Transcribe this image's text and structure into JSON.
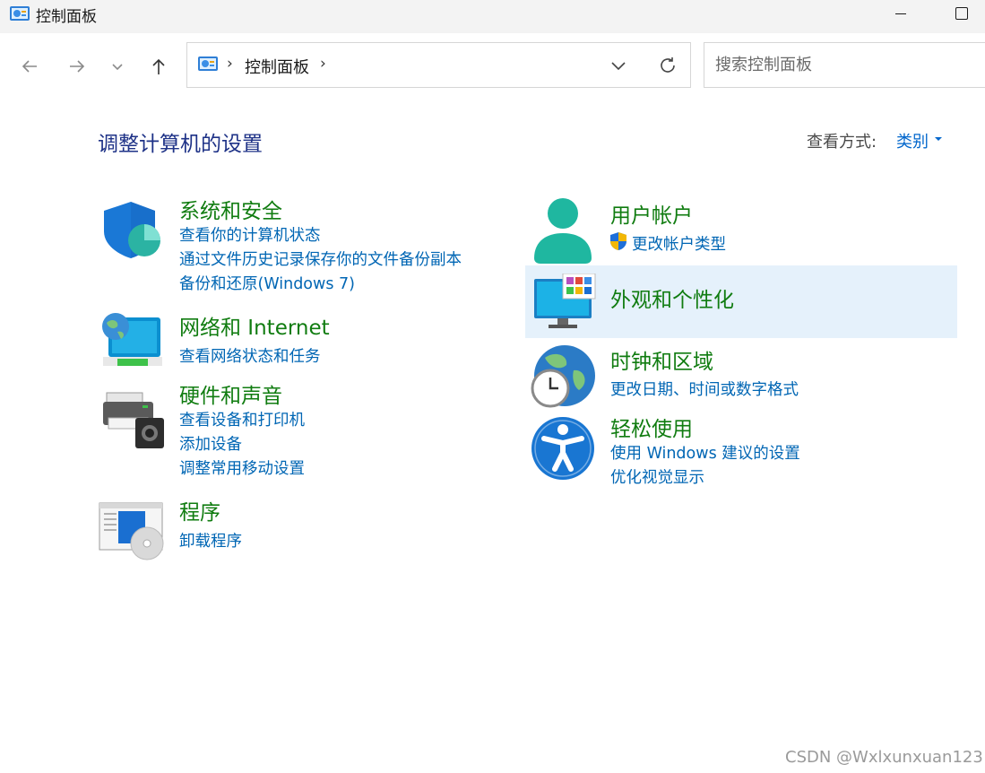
{
  "window": {
    "title": "控制面板"
  },
  "address": {
    "crumbs": [
      "控制面板"
    ]
  },
  "search": {
    "placeholder": "搜索控制面板"
  },
  "header": {
    "title": "调整计算机的设置",
    "view_label": "查看方式:",
    "view_value": "类别"
  },
  "categories": {
    "system_security": {
      "title": "系统和安全",
      "links": [
        "查看你的计算机状态",
        "通过文件历史记录保存你的文件备份副本",
        "备份和还原(Windows 7)"
      ]
    },
    "network": {
      "title": "网络和 Internet",
      "links": [
        "查看网络状态和任务"
      ]
    },
    "hardware": {
      "title": "硬件和声音",
      "links": [
        "查看设备和打印机",
        "添加设备",
        "调整常用移动设置"
      ]
    },
    "programs": {
      "title": "程序",
      "links": [
        "卸载程序"
      ]
    },
    "user_accounts": {
      "title": "用户帐户",
      "links": [
        "更改帐户类型"
      ]
    },
    "appearance": {
      "title": "外观和个性化",
      "links": []
    },
    "clock_region": {
      "title": "时钟和区域",
      "links": [
        "更改日期、时间或数字格式"
      ]
    },
    "ease_of_access": {
      "title": "轻松使用",
      "links": [
        "使用 Windows 建议的设置",
        "优化视觉显示"
      ]
    }
  },
  "watermark": "CSDN @Wxlxunxuan123",
  "colors": {
    "category_title": "#107c10",
    "link": "#0066b4",
    "page_title": "#1e3287",
    "highlight": "#e5f1fb"
  }
}
